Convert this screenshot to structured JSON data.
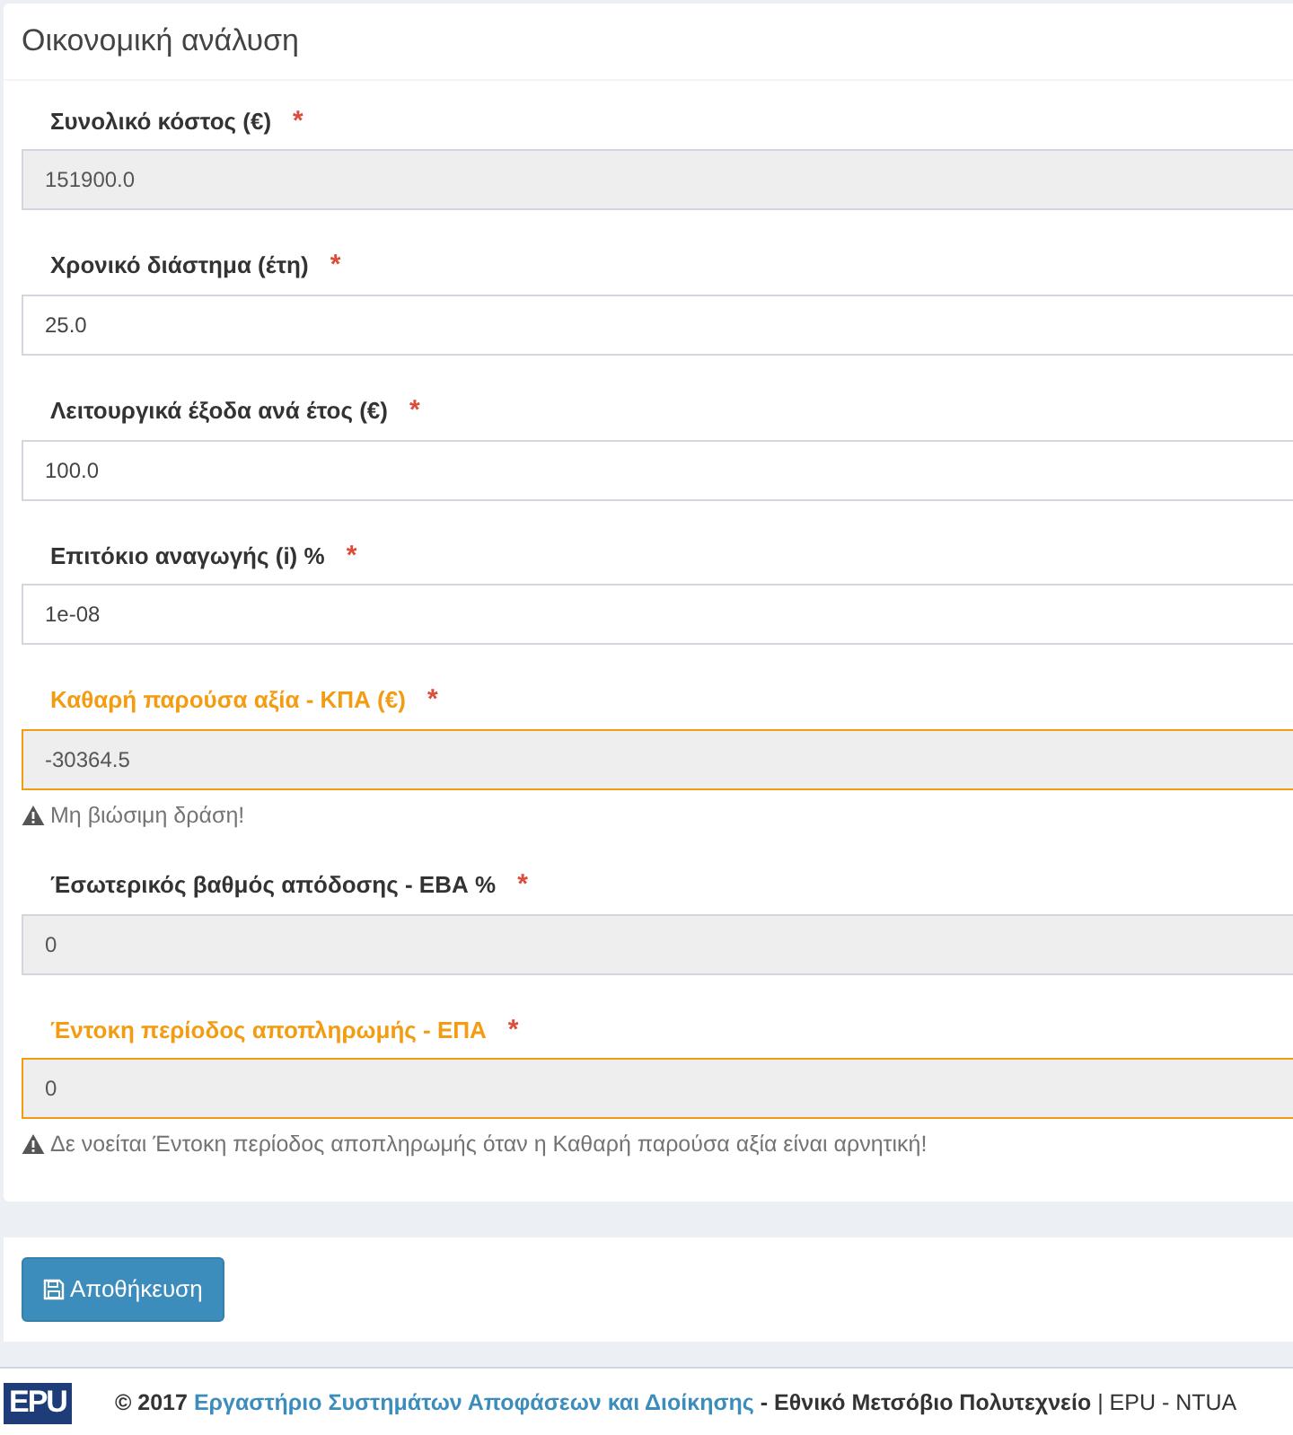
{
  "panel": {
    "title": "Οικονομική ανάλυση"
  },
  "fields": [
    {
      "label": "Συνολικό κόστος (€)",
      "required_mark": "*",
      "value": "151900.0",
      "readonly": true,
      "warning": false
    },
    {
      "label": "Χρονικό διάστημα (έτη)",
      "required_mark": "*",
      "value": "25.0",
      "readonly": false,
      "warning": false
    },
    {
      "label": "Λειτουργικά έξοδα ανά έτος (€)",
      "required_mark": "*",
      "value": "100.0",
      "readonly": false,
      "warning": false
    },
    {
      "label": "Επιτόκιο αναγωγής (i) %",
      "required_mark": "*",
      "value": "1e-08",
      "readonly": false,
      "warning": false
    },
    {
      "label": "Καθαρή παρούσα αξία - ΚΠΑ (€)",
      "required_mark": "*",
      "value": "-30364.5",
      "readonly": true,
      "warning": true,
      "help": "Μη βιώσιμη δράση!"
    },
    {
      "label": "Έσωτερικός βαθμός απόδοσης - ΕΒΑ %",
      "required_mark": "*",
      "value": "0",
      "readonly": true,
      "warning": false
    },
    {
      "label": "Έντοκη περίοδος αποπληρωμής - ΕΠΑ",
      "required_mark": "*",
      "value": "0",
      "readonly": true,
      "warning": true,
      "help": "Δε νοείται Έντοκη περίοδος αποπληρωμής όταν η Καθαρή παρούσα αξία είναι αρνητική!"
    }
  ],
  "save_button": "Αποθήκευση",
  "footer": {
    "logo": "EPU",
    "parts": [
      {
        "kind": "bold",
        "text": "© 2017 "
      },
      {
        "kind": "link",
        "text": "Εργαστήριο Συστημάτων Αποφάσεων και Διοίκησης"
      },
      {
        "kind": "bold",
        "text": " - Εθνικό Μετσόβιο Πολυτεχνείο"
      },
      {
        "kind": "plain",
        "text": " | EPU - NTUA"
      }
    ]
  }
}
